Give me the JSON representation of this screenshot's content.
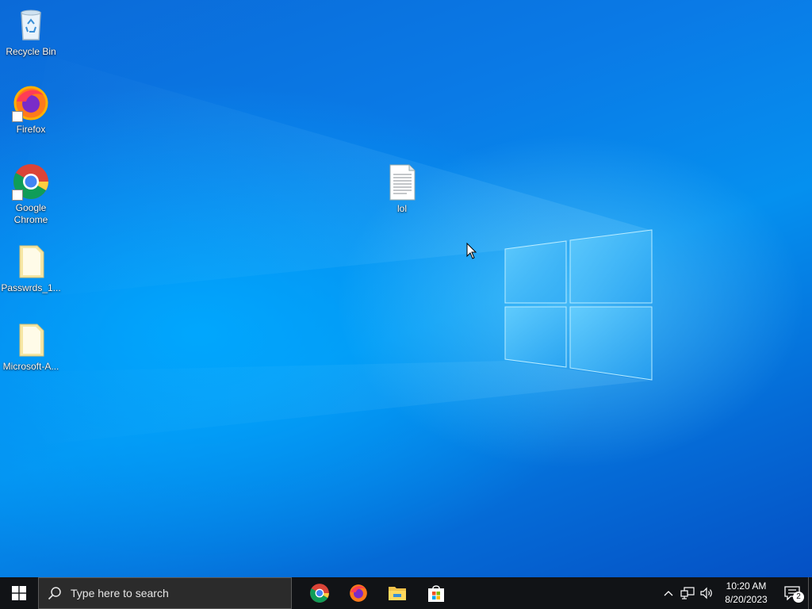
{
  "desktop": {
    "icons": [
      {
        "label": "Recycle Bin",
        "icon": "recycle-bin-icon"
      },
      {
        "label": "Firefox",
        "icon": "firefox-icon"
      },
      {
        "label": "Google Chrome",
        "icon": "chrome-icon"
      },
      {
        "label": "Passwrds_1...",
        "icon": "file-icon"
      },
      {
        "label": "Microsoft-A...",
        "icon": "file-icon"
      },
      {
        "label": "lol",
        "icon": "text-document-icon"
      }
    ]
  },
  "taskbar": {
    "search_placeholder": "Type here to search",
    "pinned_apps": [
      "chrome-icon",
      "firefox-icon",
      "file-explorer-icon",
      "microsoft-store-icon"
    ],
    "clock": {
      "time": "10:20 AM",
      "date": "8/20/2023"
    },
    "notification_count": "2"
  },
  "colors": {
    "taskbar_bg": "#111316",
    "search_bg": "#2b2b2b",
    "desktop_blue": "#0a7ae6"
  }
}
